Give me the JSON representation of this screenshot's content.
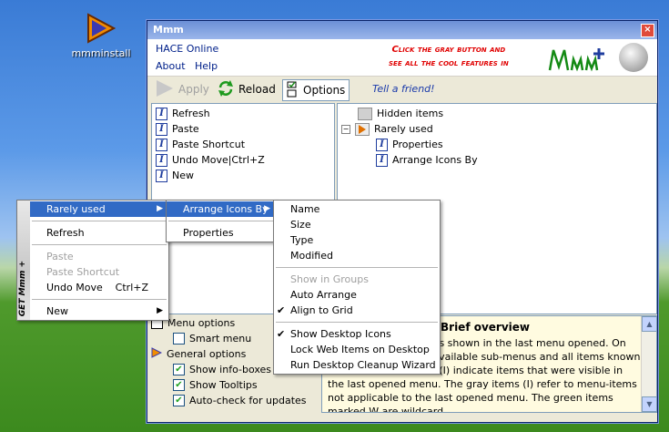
{
  "desktop": {
    "icon_label": "mmminstall"
  },
  "window": {
    "title": "Mmm",
    "close_label": "×",
    "menu": {
      "hace_online": "HACE Online",
      "about": "About",
      "help": "Help"
    },
    "promo_line1": "Click the gray button and",
    "promo_line2": "see all the cool features in",
    "logo_text": "Mmm+",
    "toolbar": {
      "apply": "Apply",
      "reload": "Reload",
      "options": "Options",
      "tell_friend": "Tell a friend!"
    },
    "left_list": [
      "Refresh",
      "Paste",
      "Paste Shortcut",
      "Undo Move|Ctrl+Z",
      "New"
    ],
    "right_tree": {
      "hidden": "Hidden items",
      "rarely": "Rarely used",
      "children": [
        "Properties",
        "Arrange Icons By"
      ]
    },
    "options_panel": {
      "menu_options": "Menu options",
      "smart_menu": "Smart menu",
      "general_options": "General options",
      "checks": [
        "Show info-boxes",
        "Show Tooltips",
        "Auto-check for updates"
      ]
    },
    "brief": {
      "title": "Brief overview",
      "text": "Here you see the items shown in the last menu opened. On the right you find all available sub-menus and all items known so far. The blue items (I) indicate items that were visible in the last opened menu. The gray items (I) refer to menu-items not applicable to the last opened menu. The green items marked W are wildcard"
    }
  },
  "context_menu": {
    "sidebar_text": "GET Mmm +",
    "items": [
      {
        "label": "Rarely used",
        "submenu": true,
        "selected": true
      },
      {
        "sep": true
      },
      {
        "label": "Refresh"
      },
      {
        "sep": true
      },
      {
        "label": "Paste",
        "disabled": true
      },
      {
        "label": "Paste Shortcut",
        "disabled": true
      },
      {
        "label": "Undo Move",
        "shortcut": "Ctrl+Z"
      },
      {
        "sep": true
      },
      {
        "label": "New",
        "submenu": true
      }
    ]
  },
  "submenu1": {
    "arrange": "Arrange Icons By",
    "properties": "Properties"
  },
  "submenu2": {
    "items": [
      {
        "label": "Name"
      },
      {
        "label": "Size"
      },
      {
        "label": "Type"
      },
      {
        "label": "Modified"
      },
      {
        "sep": true
      },
      {
        "label": "Show in Groups",
        "disabled": true
      },
      {
        "label": "Auto Arrange"
      },
      {
        "label": "Align to Grid",
        "checked": true
      },
      {
        "sep": true
      },
      {
        "label": "Show Desktop Icons",
        "checked": true
      },
      {
        "label": "Lock Web Items on Desktop"
      },
      {
        "label": "Run Desktop Cleanup Wizard"
      }
    ]
  }
}
